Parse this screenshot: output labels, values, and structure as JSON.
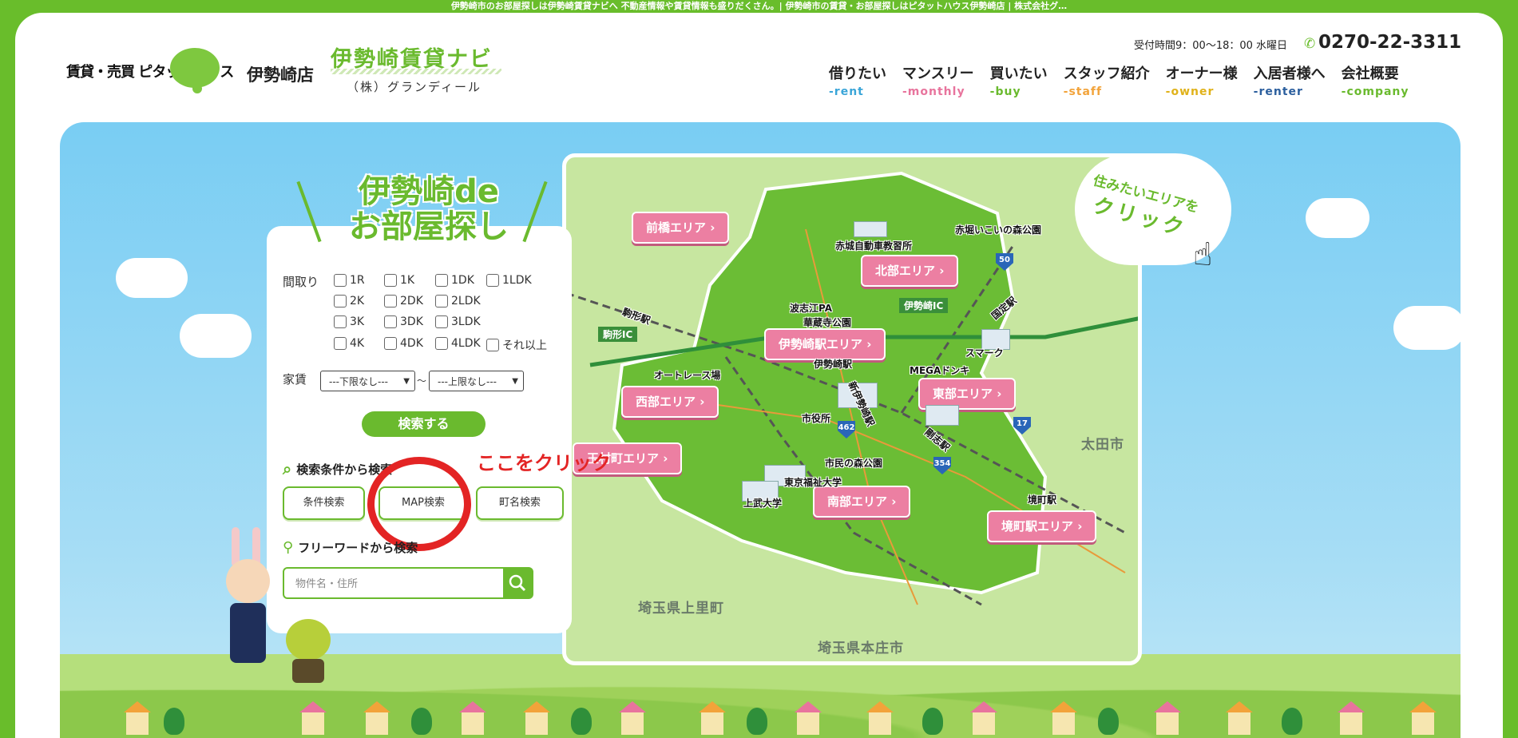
{
  "topbar": {
    "text": "伊勢崎市のお部屋探しは伊勢崎賃貸ナビへ 不動産情報や賃貸情報も盛りだくさん。| 伊勢崎市の賃貸・お部屋探しはピタットハウス伊勢崎店 | 株式会社グ…"
  },
  "header": {
    "logo_text": "賃貸・売買 ピタットハウス",
    "branch": "伊勢崎店",
    "navi_title": "伊勢崎賃貸ナビ",
    "company": "（株）グランディール",
    "hours": "受付時間9：00〜18：00 水曜日",
    "phone": "0270-22-3311"
  },
  "nav": [
    {
      "jp": "借りたい",
      "en": "-rent",
      "color": "#3aa5d8"
    },
    {
      "jp": "マンスリー",
      "en": "-monthly",
      "color": "#e8749d"
    },
    {
      "jp": "買いたい",
      "en": "-buy",
      "color": "#6aba2e"
    },
    {
      "jp": "スタッフ紹介",
      "en": "-staff",
      "color": "#f2a33a"
    },
    {
      "jp": "オーナー様",
      "en": "-owner",
      "color": "#e0b21a"
    },
    {
      "jp": "入居者様へ",
      "en": "-renter",
      "color": "#2c5f9e"
    },
    {
      "jp": "会社概要",
      "en": "-company",
      "color": "#6aba2e"
    }
  ],
  "search": {
    "title_line1": "伊勢崎de",
    "title_line2": "お部屋探し",
    "madori_label": "間取り",
    "madori": [
      "1R",
      "1K",
      "1DK",
      "1LDK",
      "2K",
      "2DK",
      "2LDK",
      "3K",
      "3DK",
      "3LDK",
      "4K",
      "4DK",
      "4LDK",
      "それ以上"
    ],
    "rent_label": "家賃",
    "rent_min": "---下限なし---",
    "rent_tilde": "〜",
    "rent_max": "---上限なし---",
    "search_button": "検索する",
    "cond_heading": "検索条件から検索",
    "tab_condition": "条件検索",
    "tab_map": "MAP検索",
    "tab_town": "町名検索",
    "free_heading": "フリーワードから検索",
    "free_placeholder": "物件名・住所",
    "click_here": "ここをクリック"
  },
  "map": {
    "areas": [
      "前橋エリア",
      "北部エリア",
      "伊勢崎駅エリア",
      "西部エリア",
      "東部エリア",
      "玉村町エリア",
      "南部エリア",
      "境町駅エリア"
    ],
    "places": [
      "赤城自動車教習所",
      "赤堀いこいの森公園",
      "波志江PA",
      "華蔵寺公園",
      "伊勢崎IC",
      "国定駅",
      "駒形駅",
      "駒形IC",
      "スマーク",
      "オートレース場",
      "伊勢崎駅",
      "MEGAドンキ",
      "新伊勢崎駅",
      "市役所",
      "剛志駅",
      "市民の森公園",
      "東京福祉大学",
      "上武大学",
      "境町駅"
    ],
    "routes": [
      "50",
      "462",
      "17",
      "354"
    ],
    "regions": [
      "太田市",
      "埼玉県上里町",
      "埼玉県本庄市"
    ]
  },
  "speech": {
    "line1": "住みたいエリアを",
    "line2": "クリック"
  }
}
